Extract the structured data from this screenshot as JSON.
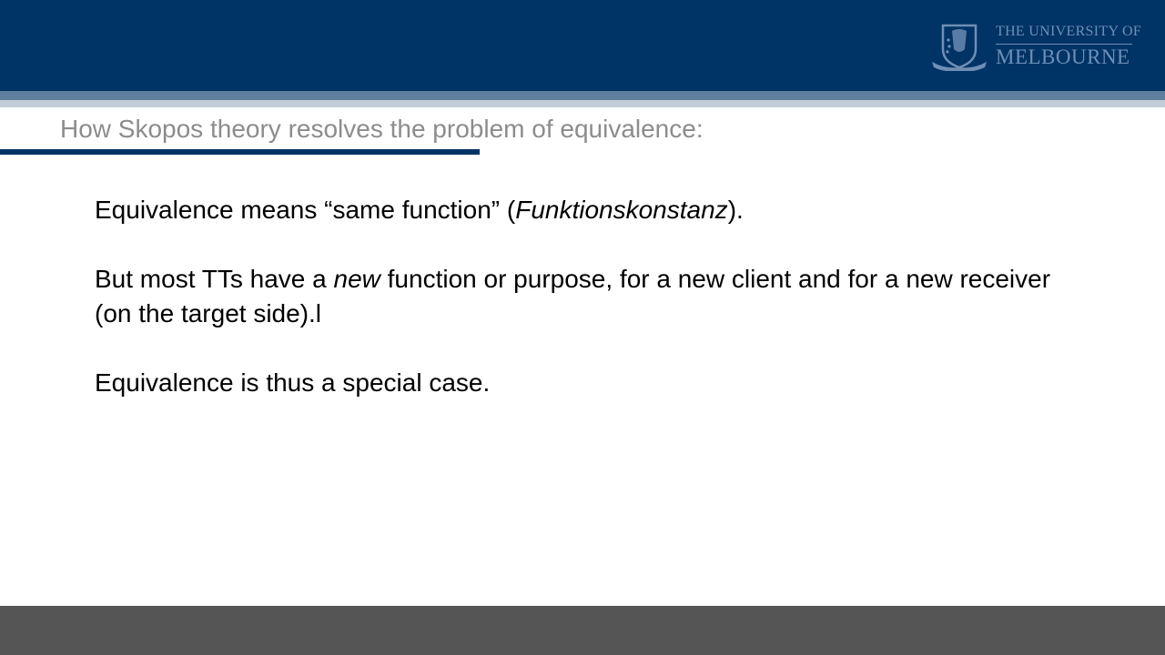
{
  "header": {
    "logo": {
      "line1": "THE UNIVERSITY OF",
      "line2": "MELBOURNE",
      "icon": "university-crest-icon"
    }
  },
  "slide": {
    "title": "How Skopos theory resolves the problem of equivalence:",
    "paragraphs": [
      {
        "before": "Equivalence means “same function” (",
        "italic": "Funktionskonstanz",
        "after": ")."
      },
      {
        "before": "But most TTs have a ",
        "italic": "new",
        "after": " function or purpose, for a new client and for a new receiver (on the target side).l"
      },
      {
        "before": "Equivalence is thus a special case.",
        "italic": "",
        "after": ""
      }
    ]
  },
  "colors": {
    "header": "#003366",
    "band_mid": "#5f7f9f",
    "band_light": "#c2ccd6",
    "title_text": "#8c8c8c",
    "footer": "#555555"
  }
}
